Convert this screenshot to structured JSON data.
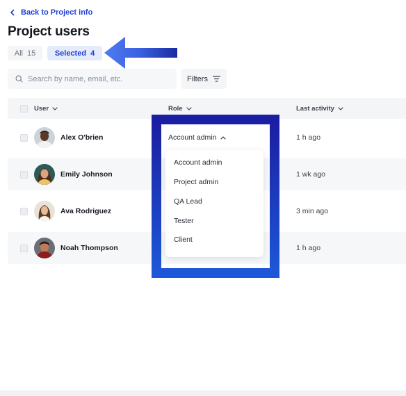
{
  "nav": {
    "back_label": "Back to Project info"
  },
  "page": {
    "title": "Project users"
  },
  "tabs": [
    {
      "label": "All",
      "count": "15"
    },
    {
      "label": "Selected",
      "count": "4"
    }
  ],
  "search": {
    "placeholder": "Search by name, email, etc."
  },
  "filters": {
    "label": "Filters"
  },
  "columns": {
    "user": "User",
    "role": "Role",
    "last_activity": "Last activity"
  },
  "rows": [
    {
      "name": "Alex O'brien",
      "last_activity": "1 h ago"
    },
    {
      "name": "Emily Johnson",
      "last_activity": "1 wk ago"
    },
    {
      "name": "Ava Rodriguez",
      "last_activity": "3 min ago"
    },
    {
      "name": "Noah Thompson",
      "last_activity": "1 h ago"
    }
  ],
  "role_dropdown": {
    "selected": "Account admin",
    "options": [
      "Account admin",
      "Project admin",
      "QA Lead",
      "Tester",
      "Client"
    ]
  },
  "annotation": {
    "arrow_color": "#4169e1",
    "box_color": "#1d3ad0"
  },
  "colors": {
    "accent": "#1f3fd6",
    "selected_tab_bg": "#e4ebfd"
  }
}
